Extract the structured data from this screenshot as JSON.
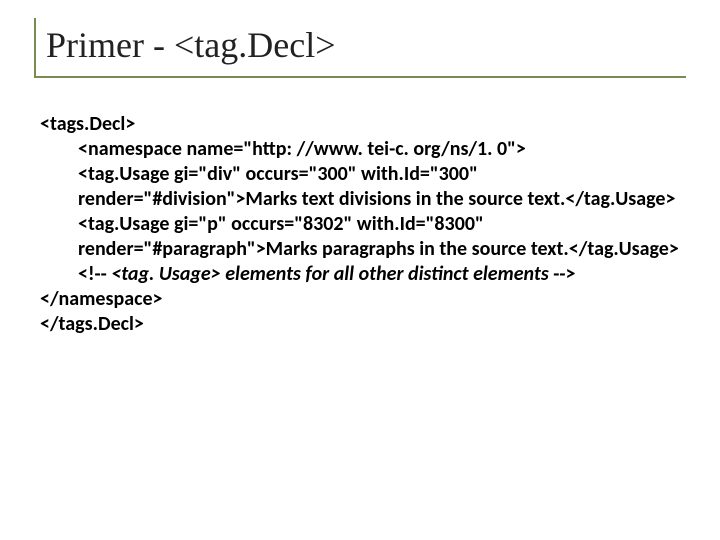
{
  "title": "Primer - <tag.Decl>",
  "code": {
    "l1": "<tags.Decl>",
    "l2": "<namespace name=\"http: //www. tei-c. org/ns/1. 0\">",
    "l3": "<tag.Usage gi=\"div\" occurs=\"300\" with.Id=\"300\" render=\"#division\">Marks text divisions in the source text.</tag.Usage>",
    "l4": "<tag.Usage gi=\"p\" occurs=\"8302\" with.Id=\"8300\" render=\"#paragraph\">Marks paragraphs in the source text.</tag.Usage>",
    "l5a": "<!-- ",
    "l5b": "<tag. Usage> elements for all other distinct elements ",
    "l5c": "-->",
    "l6": "</namespace>",
    "l7": "</tags.Decl>"
  }
}
